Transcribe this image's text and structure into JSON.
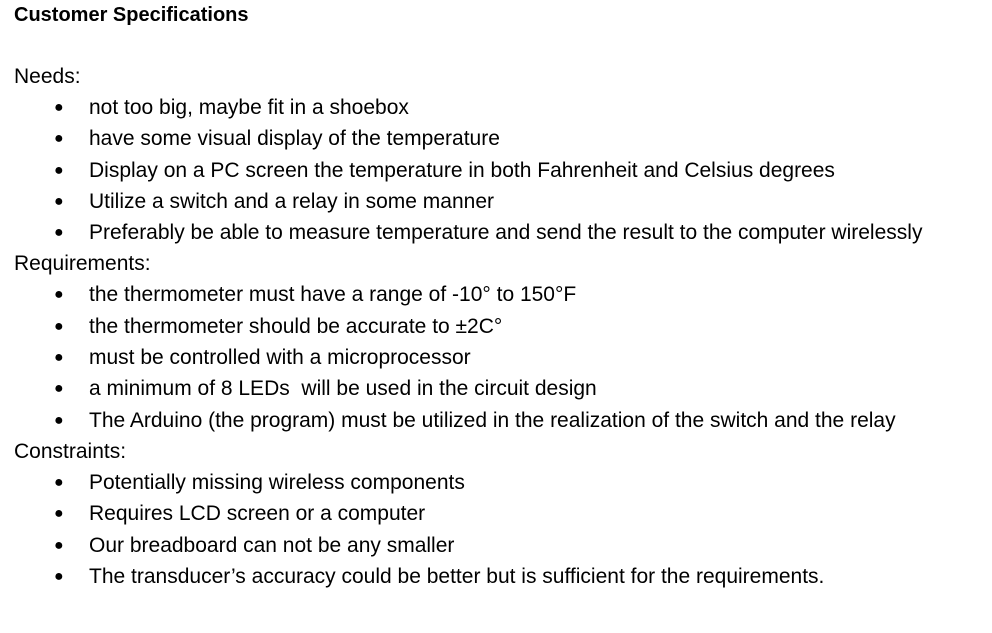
{
  "document": {
    "title": "Customer Specifications",
    "sections": [
      {
        "heading": "Needs:",
        "items": [
          "not too big, maybe fit in a shoebox",
          "have some visual display of the temperature",
          "Display on a PC screen the temperature in both Fahrenheit and Celsius degrees",
          "Utilize a switch and a relay in some manner",
          "Preferably be able to measure temperature and send the result to the computer wirelessly"
        ]
      },
      {
        "heading": "Requirements:",
        "items": [
          "the thermometer must have a range of -10° to 150°F",
          "the thermometer should be accurate to ±2C°",
          "must be controlled with a microprocessor",
          "a minimum of 8 LEDs  will be used in the circuit design",
          "The Arduino (the program) must be utilized in the realization of the switch and the relay"
        ]
      },
      {
        "heading": "Constraints:",
        "items": [
          "Potentially missing wireless components",
          "Requires LCD screen or a computer",
          "Our breadboard can not be any smaller",
          "The transducer’s accuracy could be better but is sufficient for the requirements."
        ]
      }
    ],
    "bullet_glyph": "●"
  }
}
